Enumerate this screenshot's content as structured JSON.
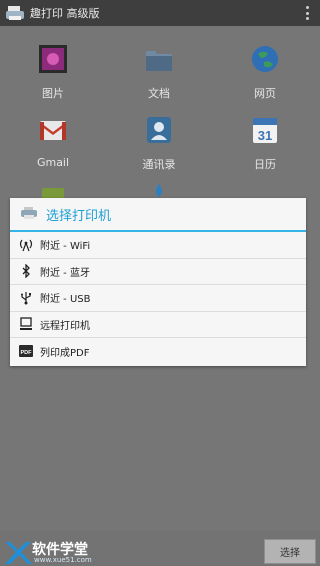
{
  "app": {
    "title": "趣打印 高级版"
  },
  "grid": [
    {
      "label": "图片",
      "icon": "photo-icon",
      "color": "#9a2a7c"
    },
    {
      "label": "文档",
      "icon": "folder-icon",
      "color": "#5f7a93"
    },
    {
      "label": "网页",
      "icon": "globe-icon",
      "color": "#2f6bb0"
    },
    {
      "label": "Gmail",
      "icon": "gmail-icon",
      "color": "#c43a2a"
    },
    {
      "label": "通讯录",
      "icon": "contacts-icon",
      "color": "#3b6f9c"
    },
    {
      "label": "日历",
      "icon": "calendar-icon",
      "color": "#3d74b5"
    }
  ],
  "dialog": {
    "title": "选择打印机",
    "options": [
      {
        "label": "附近 - WiFi",
        "icon": "wifi-antenna-icon"
      },
      {
        "label": "附近 - 蓝牙",
        "icon": "bluetooth-icon"
      },
      {
        "label": "附近 - USB",
        "icon": "usb-icon"
      },
      {
        "label": "远程打印机",
        "icon": "computer-icon"
      },
      {
        "label": "列印成PDF",
        "icon": "pdf-icon"
      }
    ]
  },
  "bottom": {
    "select_label": "选择"
  },
  "watermark": {
    "title": "软件学堂",
    "url": "www.xue51.com"
  }
}
